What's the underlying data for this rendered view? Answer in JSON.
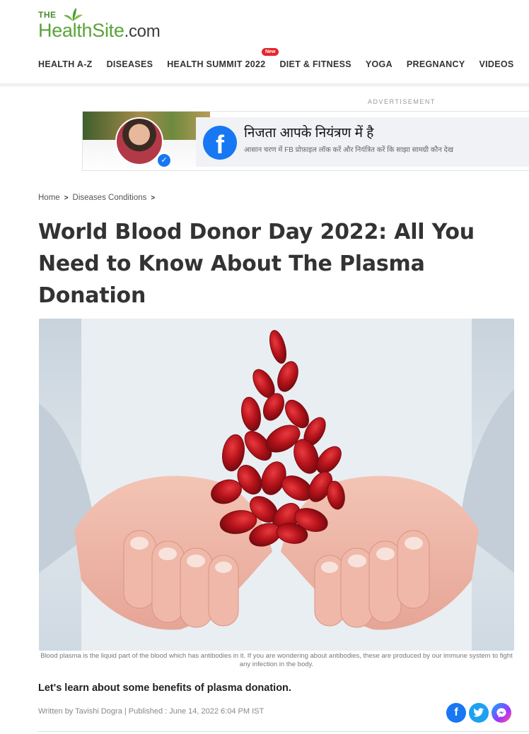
{
  "logo": {
    "prefix": "THE",
    "health": "Health",
    "site": "Site",
    "domain": ".com"
  },
  "nav": {
    "items": [
      "HEALTH A-Z",
      "DISEASES",
      "HEALTH SUMMIT 2022",
      "DIET & FITNESS",
      "YOGA",
      "PREGNANCY",
      "VIDEOS"
    ],
    "badge": "New"
  },
  "ad": {
    "label": "ADVERTISEMENT",
    "title": "निजता आपके नियंत्रण में है",
    "subtitle": "आसान चरण में FB प्रोफ़ाइल लॉक करें और नियंत्रित करें कि साझा सामग्री कौन देख",
    "fb_glyph": "f"
  },
  "breadcrumb": {
    "home": "Home",
    "section": "Diseases Conditions",
    "separator": ">"
  },
  "article": {
    "title": "World Blood Donor Day 2022: All You Need to Know About The Plasma Donation",
    "caption": "Blood plasma is the liquid part of the blood which has antibodies in it. If you are wondering about antibodies, these are produced by our immune system to fight any infection in the body.",
    "lead": "Let's learn about some benefits of plasma donation.",
    "byline": "Written by Tavishi Dogra | Published : June 14, 2022 6:04 PM IST"
  },
  "share": {
    "facebook": "f",
    "twitter": "t",
    "messenger": "m"
  },
  "colors": {
    "brand_green": "#5aa43a",
    "facebook": "#1877f2",
    "twitter": "#1da1f2",
    "blood_red": "#c8161d"
  }
}
